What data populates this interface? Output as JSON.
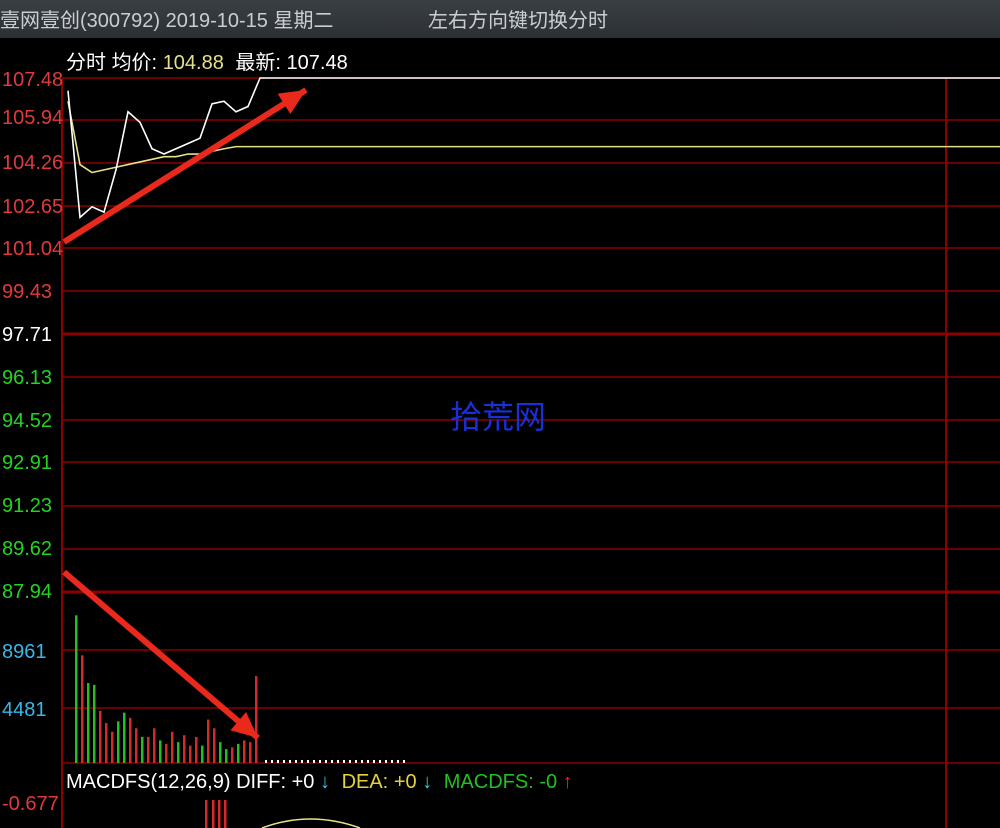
{
  "titlebar": {
    "stock": "壹网壹创(300792) 2019-10-15 星期二",
    "hint": "左右方向键切换分时"
  },
  "header": {
    "label": "分时",
    "avg_label": "均价:",
    "avg_value": "104.88",
    "latest_label": "最新:",
    "latest_value": "107.48"
  },
  "price_axis": {
    "labels": [
      "107.48",
      "105.94",
      "104.26",
      "102.65",
      "101.04",
      "99.43",
      "97.71",
      "96.13",
      "94.52",
      "92.91",
      "91.23",
      "89.62",
      "87.94"
    ],
    "colors": [
      "#e03a3a",
      "#e03a3a",
      "#e03a3a",
      "#e03a3a",
      "#e03a3a",
      "#e03a3a",
      "#ffffff",
      "#22d422",
      "#22d422",
      "#22d422",
      "#22d422",
      "#22d422",
      "#22d422"
    ]
  },
  "volume_axis": {
    "labels": [
      "8961",
      "4481"
    ],
    "color": "#39b7e8"
  },
  "macd": {
    "name": "MACDFS(12,26,9)",
    "diff_label": "DIFF:",
    "diff_value": "+0",
    "dea_label": "DEA:",
    "dea_value": "+0",
    "macdfs_label": "MACDFS:",
    "macdfs_value": "-0",
    "axis_label": "-0.677"
  },
  "watermark": "拾荒网",
  "colors": {
    "grid": "#8b0000",
    "price_line": "#ffffff",
    "avg_line": "#e6e08a",
    "arrow": "#e8291c",
    "up_bar": "#d42a2a",
    "down_bar": "#22c022"
  },
  "chart_data": {
    "type": "line",
    "series": [
      {
        "values": [
          107.0,
          102.2,
          102.6,
          102.4,
          104.0,
          106.2,
          105.8,
          104.8,
          104.6,
          104.8,
          105.0,
          105.2,
          106.5,
          106.6,
          106.2,
          106.4,
          107.48
        ]
      },
      {
        "values": [
          106.6,
          104.2,
          103.9,
          104.0,
          104.1,
          104.2,
          104.3,
          104.4,
          104.5,
          104.5,
          104.6,
          104.6,
          104.7,
          104.8,
          104.88,
          104.88,
          104.88
        ]
      }
    ],
    "volume": [
      8500,
      6200,
      4600,
      4500,
      3000,
      2300,
      1800,
      2400,
      2900,
      2600,
      2000,
      1500,
      1500,
      2000,
      1300,
      1100,
      1800,
      1200,
      1600,
      1000,
      1500,
      1000,
      2500,
      2000,
      1200,
      800,
      900,
      1100,
      1300,
      1200,
      5000
    ],
    "volume_up": [
      false,
      true,
      false,
      false,
      true,
      true,
      true,
      false,
      false,
      true,
      true,
      false,
      true,
      true,
      false,
      true,
      true,
      false,
      true,
      true,
      true,
      false,
      true,
      true,
      false,
      false,
      true,
      false,
      true,
      true,
      true
    ]
  }
}
